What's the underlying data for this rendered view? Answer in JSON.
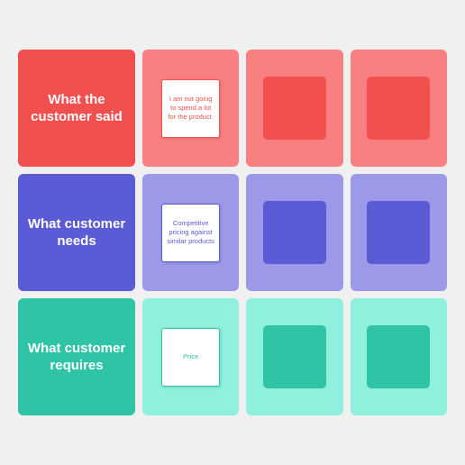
{
  "rows": [
    {
      "id": "row-red",
      "label": "What the customer said",
      "color_class": "row-red",
      "sticky_text": "I am not going to spend a lot for the product.",
      "col3_empty": true,
      "col4_empty": true
    },
    {
      "id": "row-purple",
      "label": "What customer needs",
      "color_class": "row-purple",
      "sticky_text": "Competitive pricing against similar products",
      "col3_empty": true,
      "col4_empty": true
    },
    {
      "id": "row-teal",
      "label": "What customer requires",
      "color_class": "row-teal",
      "sticky_text": "Price",
      "col3_empty": true,
      "col4_empty": true
    }
  ]
}
